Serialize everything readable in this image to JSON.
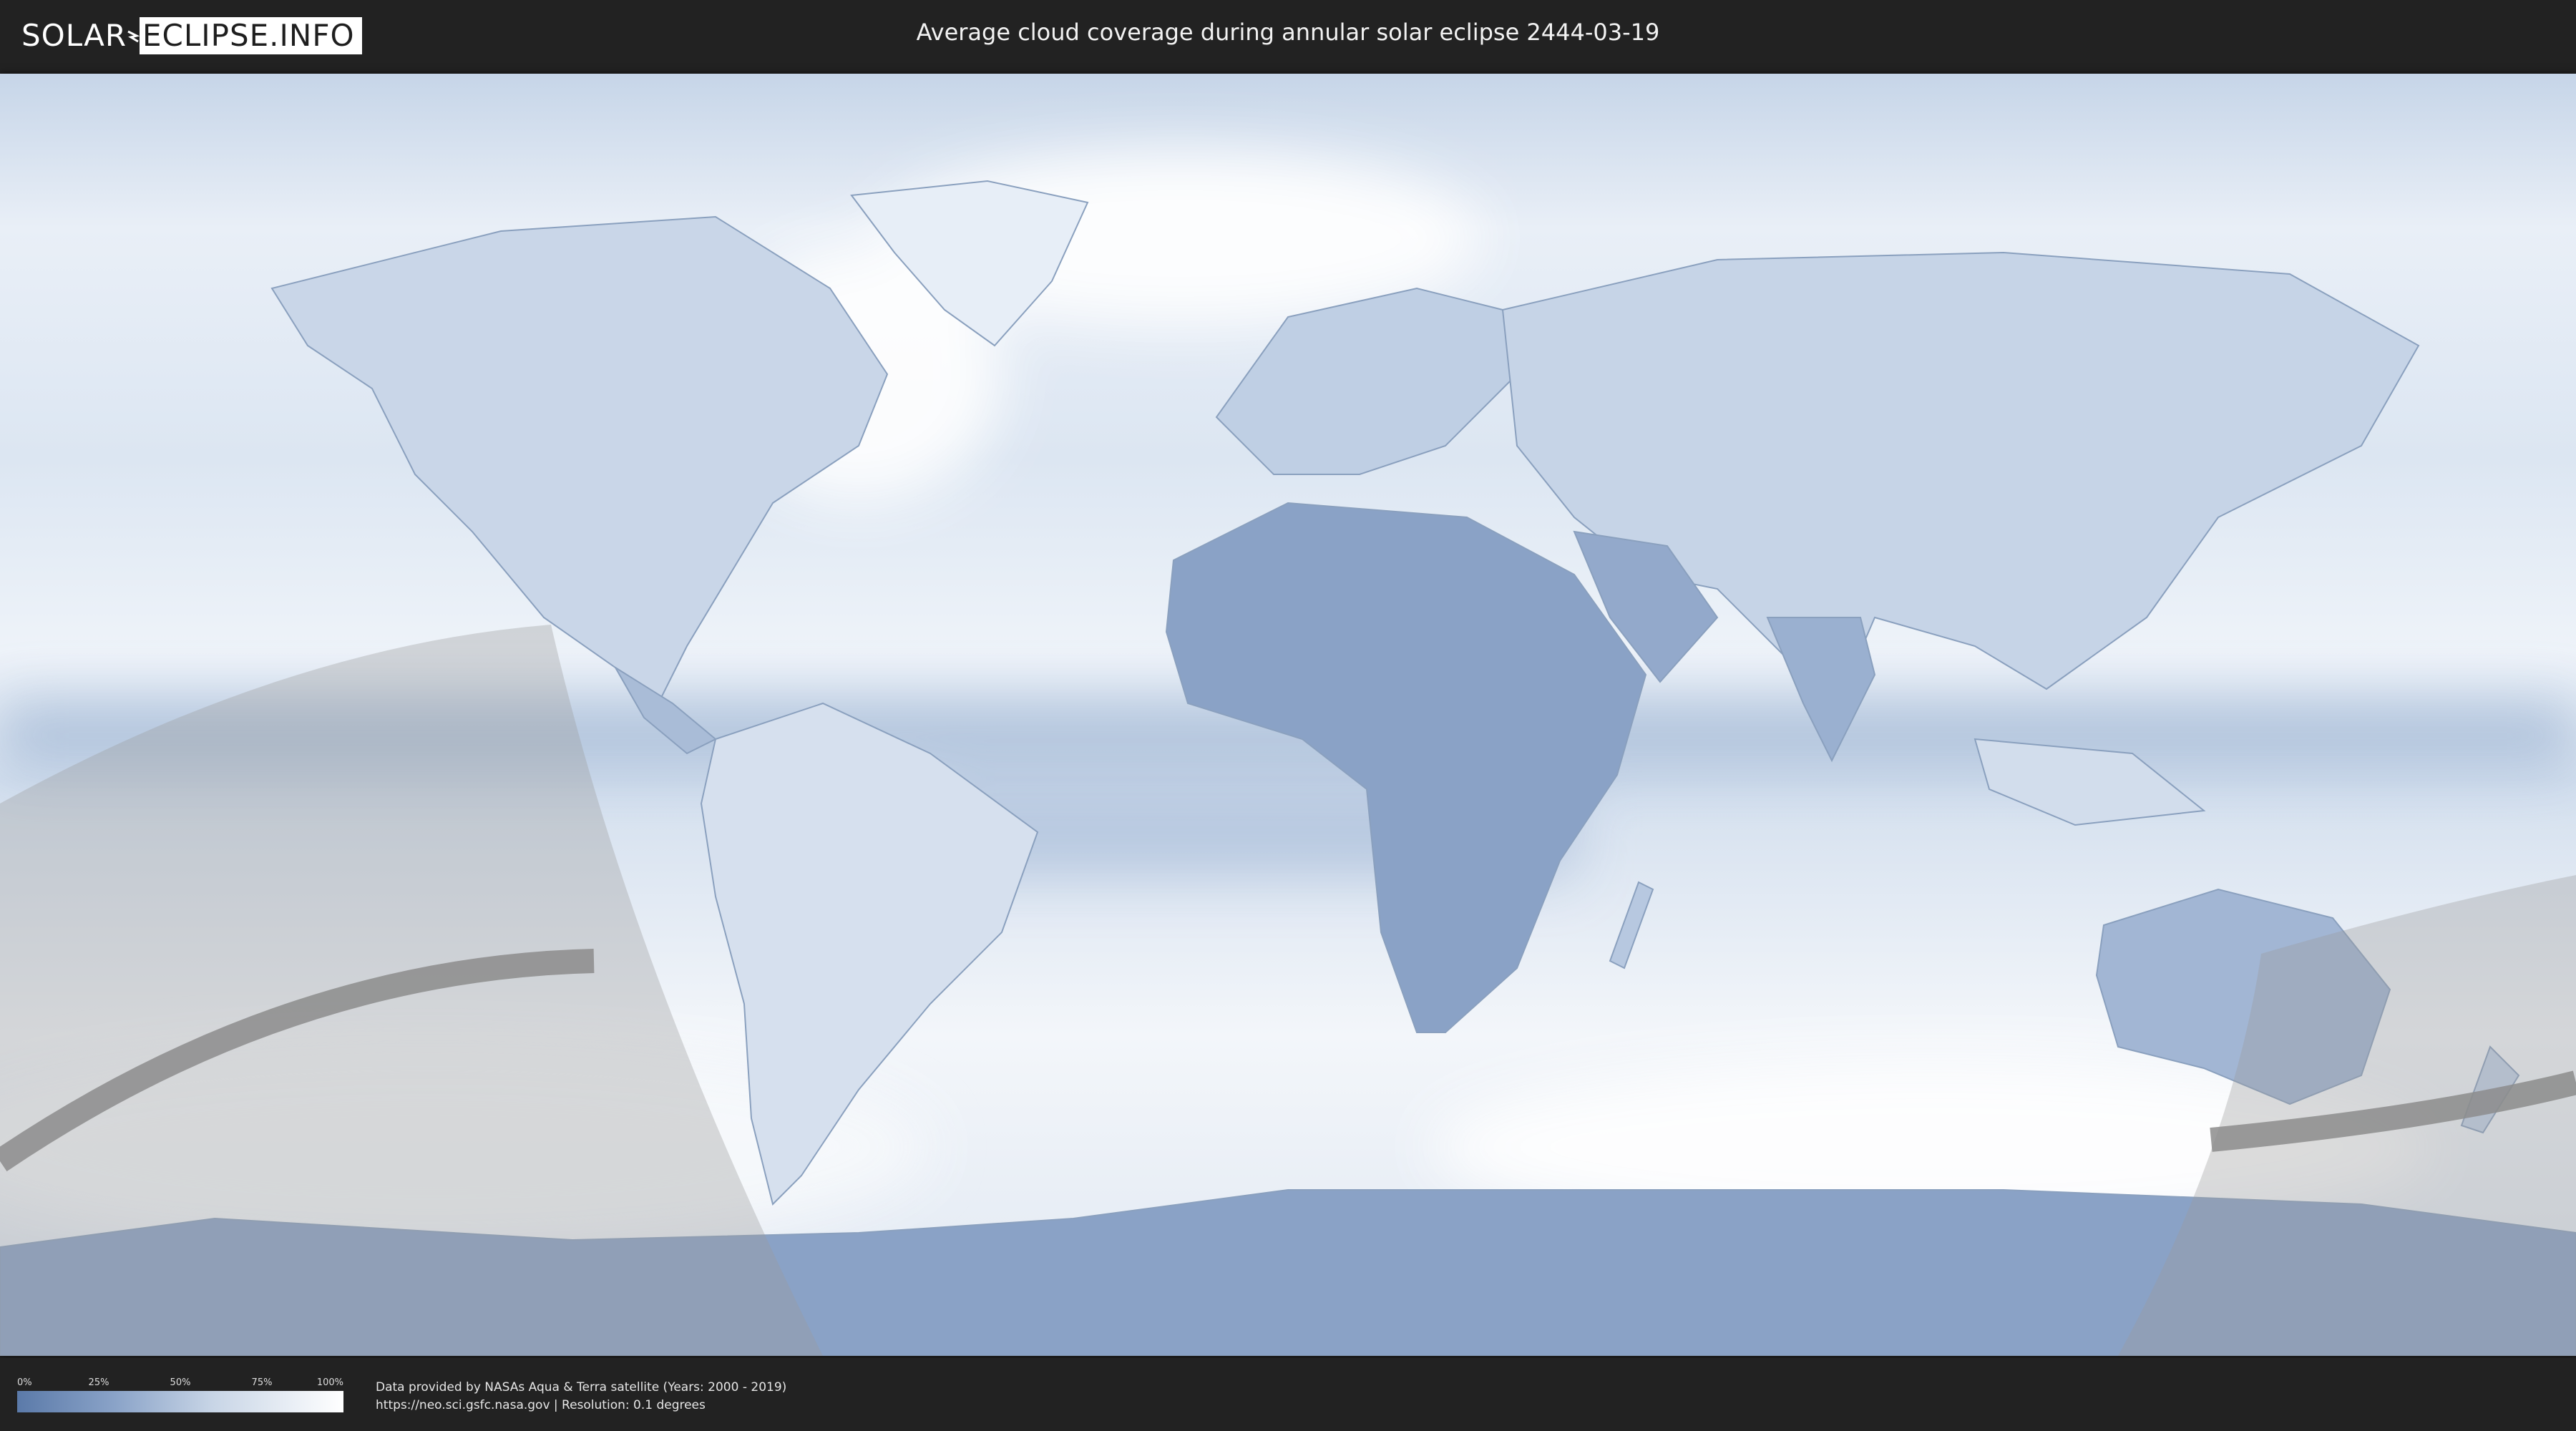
{
  "header": {
    "logo_solar": "SOLAR",
    "logo_eclipse": "ECLIPSE.INFO",
    "title": "Average cloud coverage during annular solar eclipse 2444-03-19"
  },
  "legend": {
    "ticks": [
      "0%",
      "25%",
      "50%",
      "75%",
      "100%"
    ],
    "colors": {
      "low": "#5b7aa9",
      "high": "#ffffff"
    }
  },
  "credits": {
    "line1": "Data provided by NASAs Aqua & Terra satellite (Years: 2000 - 2019)",
    "line2": "https://neo.sci.gsfc.nasa.gov | Resolution: 0.1 degrees"
  },
  "map": {
    "projection": "equirectangular",
    "ocean_color": "#dfe8f3",
    "cloud_clear_color": "#5f7fad",
    "shadow_color": "#b4b4b4"
  }
}
